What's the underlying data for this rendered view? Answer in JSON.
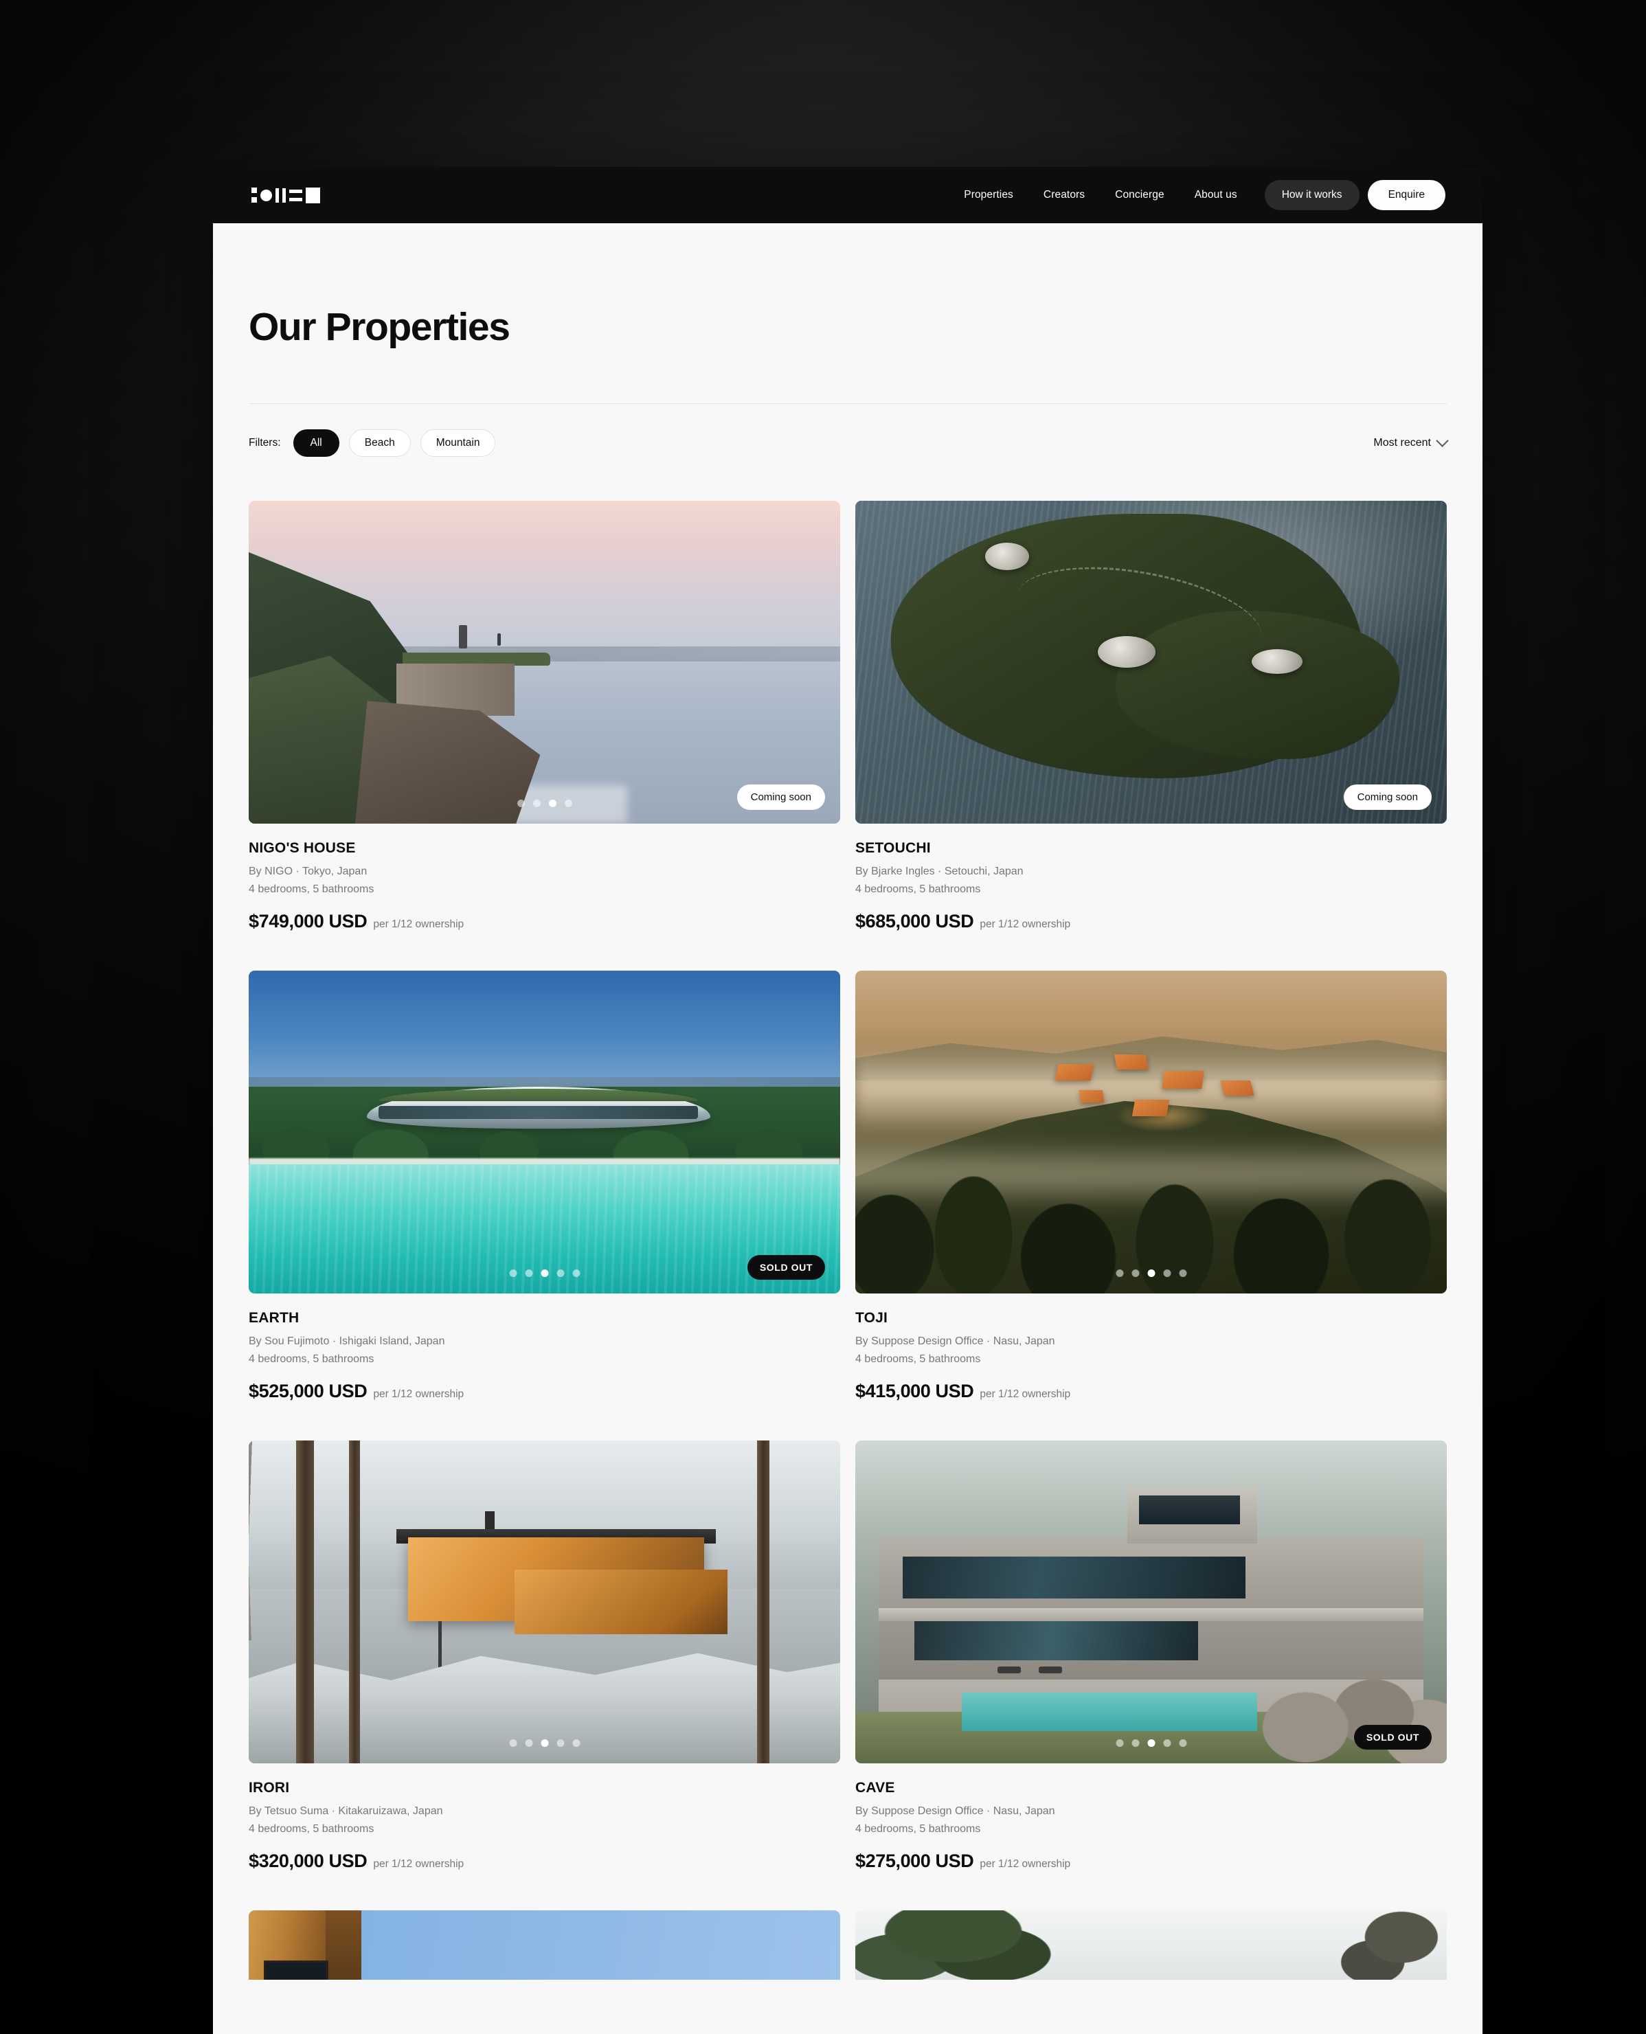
{
  "header": {
    "logo_name": "oii-logo",
    "nav_links": [
      "Properties",
      "Creators",
      "Concierge",
      "About us"
    ],
    "how_it_works_label": "How it works",
    "enquire_label": "Enquire"
  },
  "page": {
    "title": "Our Properties"
  },
  "filters": {
    "label": "Filters:",
    "chips": [
      {
        "label": "All",
        "active": true
      },
      {
        "label": "Beach",
        "active": false
      },
      {
        "label": "Mountain",
        "active": false
      }
    ],
    "sort_label": "Most recent",
    "sort_icon": "chevron-down-icon"
  },
  "properties": [
    {
      "name": "NIGO'S HOUSE",
      "byline": "By NIGO · Tokyo, Japan",
      "rooms": "4 bedrooms, 5 bathrooms",
      "price": "$749,000 USD",
      "price_sub": "per 1/12 ownership",
      "badge": "Coming soon",
      "badge_type": "soon",
      "dots": 4,
      "active_dot": 2,
      "scene": "nigo"
    },
    {
      "name": "SETOUCHI",
      "byline": "By Bjarke Ingles · Setouchi, Japan",
      "rooms": "4 bedrooms, 5 bathrooms",
      "price": "$685,000 USD",
      "price_sub": "per 1/12 ownership",
      "badge": "Coming soon",
      "badge_type": "soon",
      "dots": 0,
      "active_dot": -1,
      "scene": "setouchi"
    },
    {
      "name": "EARTH",
      "byline": "By Sou Fujimoto · Ishigaki Island, Japan",
      "rooms": "4 bedrooms, 5 bathrooms",
      "price": "$525,000 USD",
      "price_sub": "per 1/12 ownership",
      "badge": "SOLD OUT",
      "badge_type": "sold",
      "dots": 5,
      "active_dot": 2,
      "scene": "earth"
    },
    {
      "name": "TOJI",
      "byline": "By Suppose Design Office · Nasu, Japan",
      "rooms": "4 bedrooms, 5 bathrooms",
      "price": "$415,000 USD",
      "price_sub": "per 1/12 ownership",
      "badge": "",
      "badge_type": "none",
      "dots": 5,
      "active_dot": 2,
      "scene": "toji"
    },
    {
      "name": "IRORI",
      "byline": "By Tetsuo Suma · Kitakaruizawa, Japan",
      "rooms": "4 bedrooms, 5 bathrooms",
      "price": "$320,000 USD",
      "price_sub": "per 1/12 ownership",
      "badge": "",
      "badge_type": "none",
      "dots": 5,
      "active_dot": 2,
      "scene": "irori"
    },
    {
      "name": "CAVE",
      "byline": "By Suppose Design Office · Nasu, Japan",
      "rooms": "4 bedrooms, 5 bathrooms",
      "price": "$275,000 USD",
      "price_sub": "per 1/12 ownership",
      "badge": "SOLD OUT",
      "badge_type": "sold",
      "dots": 5,
      "active_dot": 2,
      "scene": "cave"
    }
  ],
  "partial_row": [
    {
      "scene": "rust"
    },
    {
      "scene": "willow"
    }
  ],
  "colors": {
    "page_bg": "#f8f8f9",
    "header_bg": "#0d0d0f",
    "accent_dark": "#0d0d0f",
    "muted_text": "#76777d",
    "chip_border": "#e2e2e5"
  }
}
